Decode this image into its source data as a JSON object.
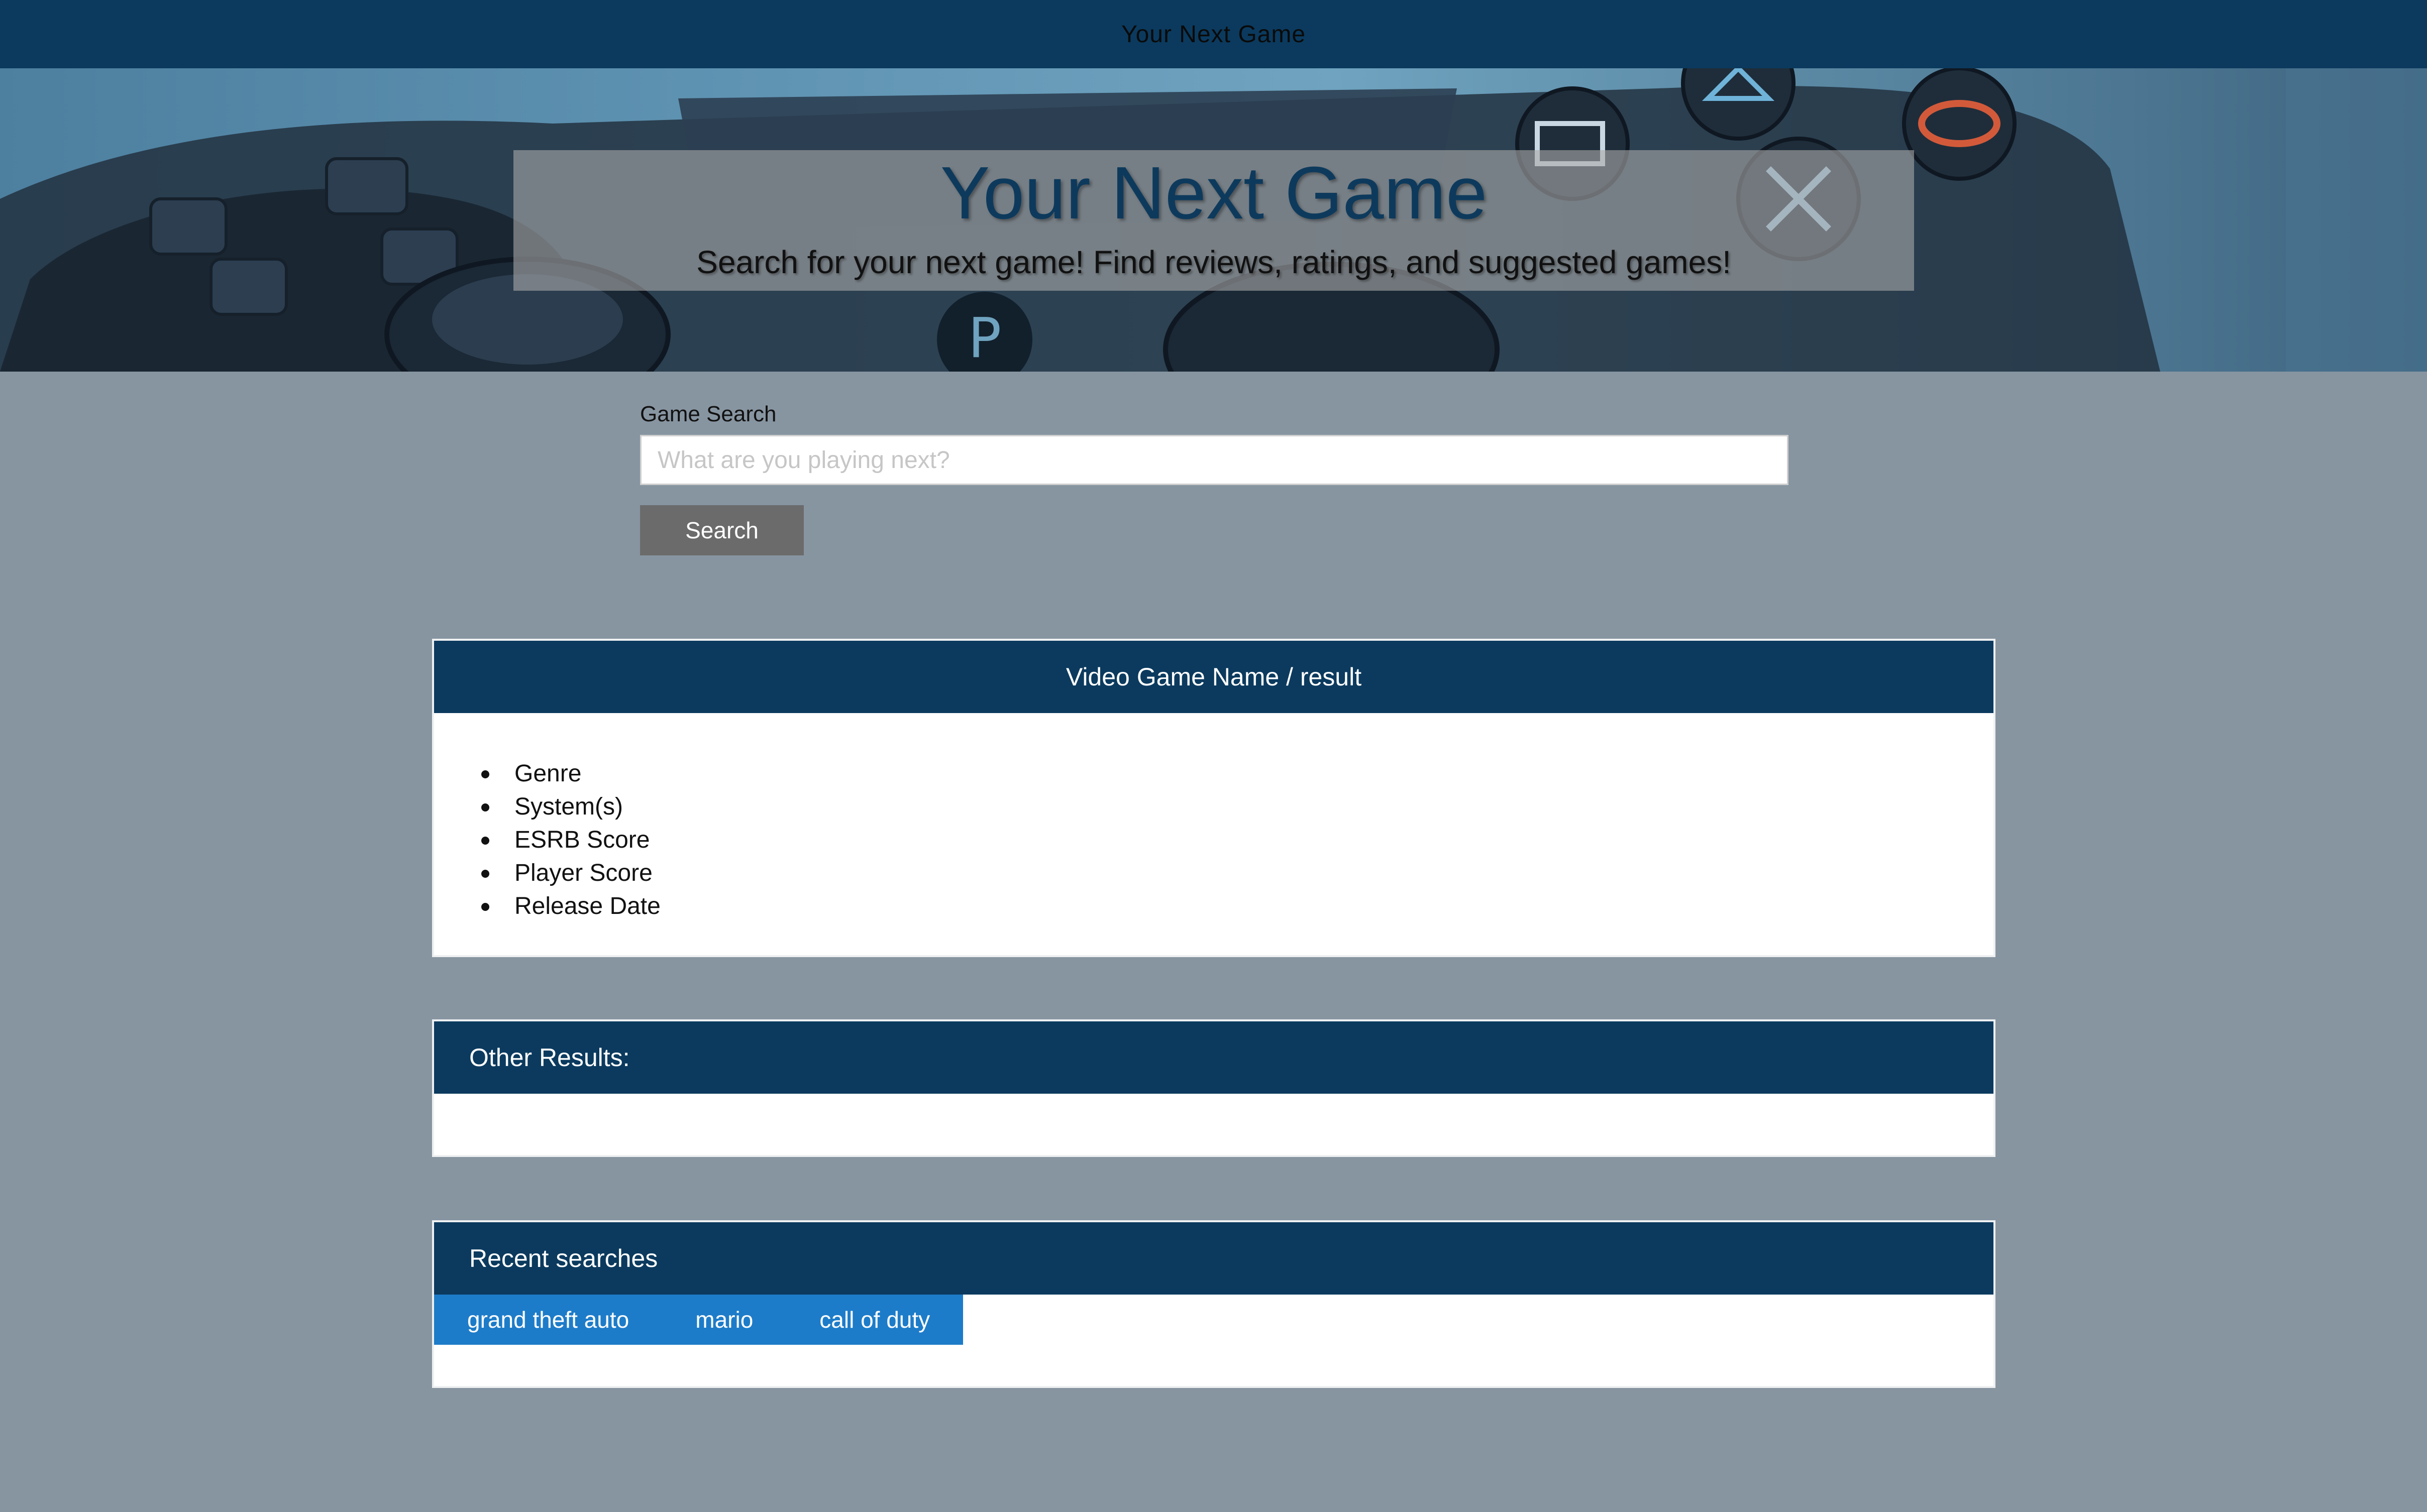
{
  "topbar": {
    "title": "Your Next Game"
  },
  "hero": {
    "title": "Your Next Game",
    "subtitle": "Search for your next game! Find reviews, ratings, and suggested games!"
  },
  "search": {
    "label": "Game Search",
    "placeholder": "What are you playing next?",
    "button_label": "Search"
  },
  "result": {
    "header": "Video Game Name / result",
    "fields": [
      "Genre",
      "System(s)",
      "ESRB Score",
      "Player Score",
      "Release Date"
    ]
  },
  "other_results": {
    "header": "Other Results:"
  },
  "recent": {
    "header": "Recent searches",
    "items": [
      "grand theft auto",
      "mario",
      "call of duty"
    ]
  },
  "colors": {
    "page_background": "#8795a1",
    "header_navy": "#0b3a5e",
    "chip_blue": "#1d7cc9",
    "button_gray": "#6b6b6b"
  }
}
